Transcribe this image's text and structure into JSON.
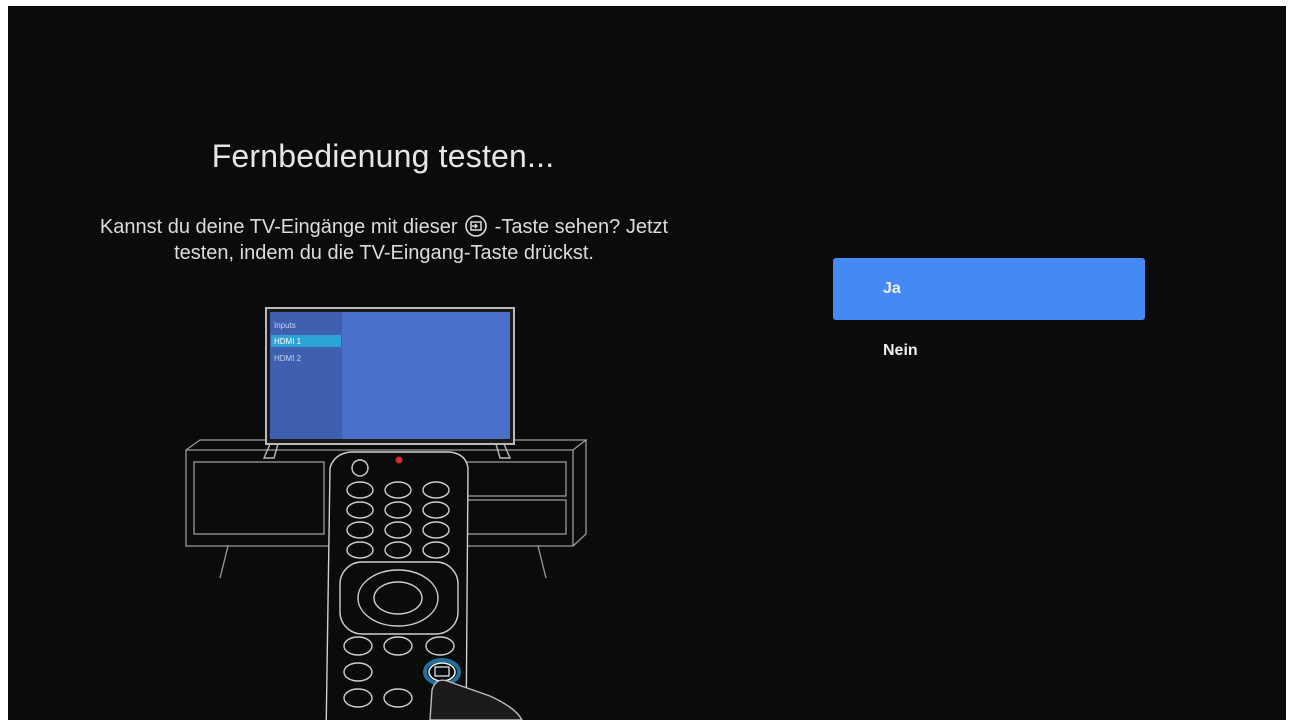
{
  "screen": {
    "title": "Fernbedienung testen...",
    "description_before_icon": "Kannst du deine TV-Eingänge mit dieser",
    "description_after_icon": "-Taste sehen? Jetzt",
    "description_line2": "testen, indem du die TV-Eingang-Taste drückst."
  },
  "illustration": {
    "tv_menu_header": "Inputs",
    "tv_menu_items": [
      "HDMI 1",
      "HDMI 2"
    ],
    "selected_item_index": 0
  },
  "options": [
    {
      "label": "Ja",
      "selected": true
    },
    {
      "label": "Nein",
      "selected": false
    }
  ],
  "colors": {
    "background": "#0b0b0b",
    "accent": "#4589f5",
    "tv_screen": "#4a70c9",
    "tv_highlight": "#2ea3d8",
    "remote_glow": "#2fb7ff"
  }
}
